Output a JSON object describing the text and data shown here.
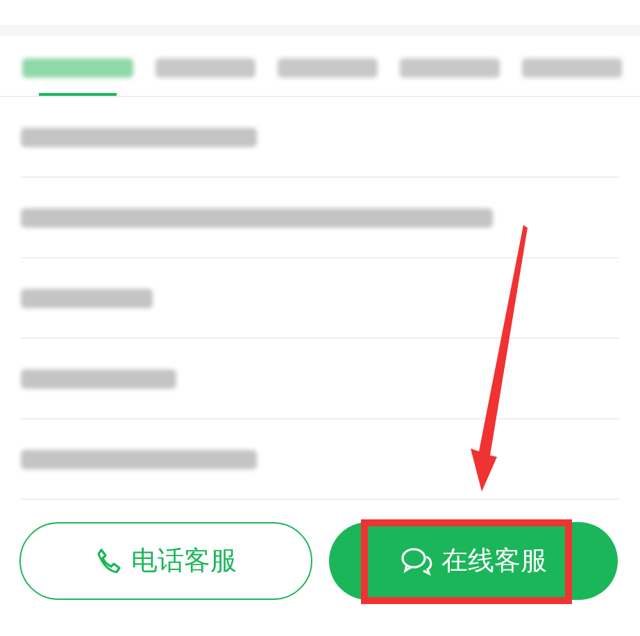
{
  "tabs": [
    {
      "selected": true
    },
    {
      "selected": false
    },
    {
      "selected": false
    },
    {
      "selected": false
    },
    {
      "selected": false
    }
  ],
  "rows": [
    {
      "blurred": true
    },
    {
      "blurred": true
    },
    {
      "blurred": true
    },
    {
      "blurred": true
    },
    {
      "blurred": true
    }
  ],
  "buttons": [
    {
      "kind": "phone",
      "label": "电话客服"
    },
    {
      "kind": "chat",
      "label": "在线客服"
    }
  ],
  "annotation_arrow": true,
  "highlight_frame": true
}
